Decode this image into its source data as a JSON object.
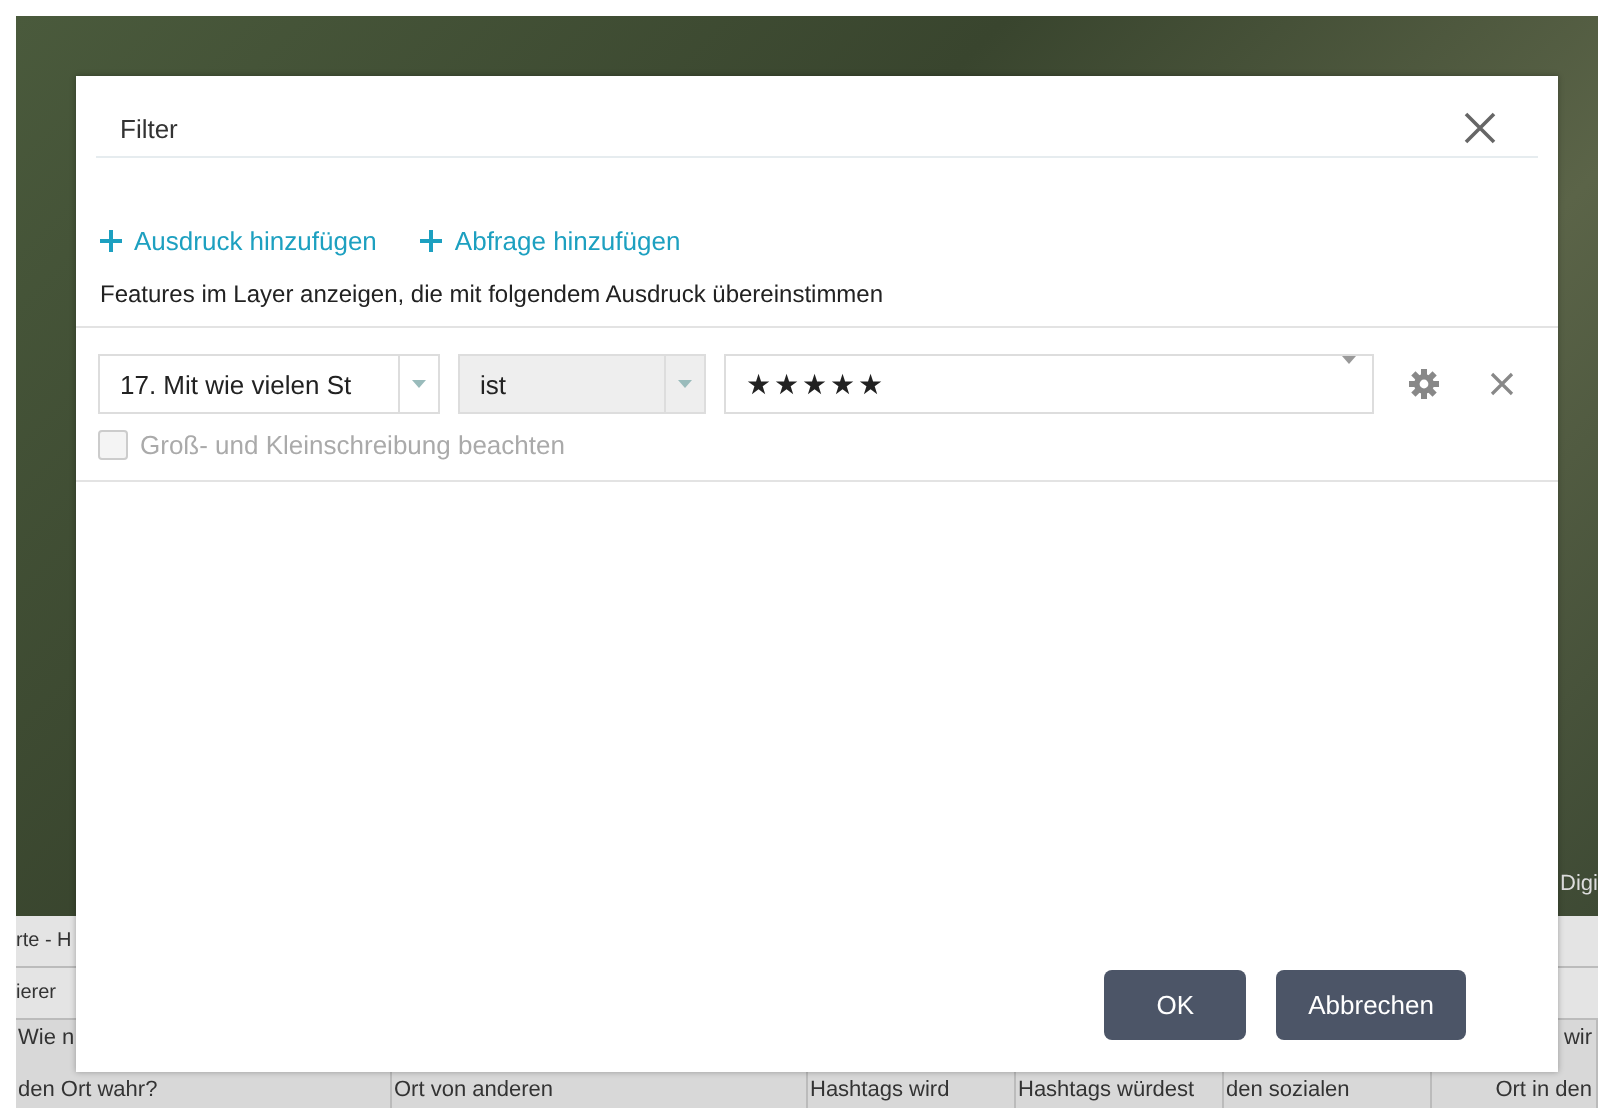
{
  "background": {
    "map_label": "Digi",
    "table": {
      "header": "rte - H",
      "toolbar": "ierer",
      "cells": [
        {
          "lines": [
            "Wie n",
            "den Ort wahr?"
          ]
        },
        {
          "lines": [
            "Ort von anderen"
          ]
        },
        {
          "lines": [
            "Hashtags wird"
          ]
        },
        {
          "lines": [
            "Hashtags würdest"
          ]
        },
        {
          "lines": [
            "den sozialen"
          ]
        },
        {
          "lines": [
            "wir",
            "Ort in den"
          ]
        }
      ]
    }
  },
  "dialog": {
    "title": "Filter",
    "actions": [
      {
        "label": "Ausdruck hinzufügen"
      },
      {
        "label": "Abfrage hinzufügen"
      }
    ],
    "description": "Features im Layer anzeigen, die mit folgendem Ausdruck übereinstimmen",
    "expression": {
      "field": "17. Mit wie vielen St",
      "operator": "ist",
      "value": "★★★★★",
      "case_sensitive": {
        "label": "Groß- und Kleinschreibung beachten",
        "checked": false,
        "disabled": true
      }
    },
    "buttons": [
      {
        "label": "OK"
      },
      {
        "label": "Abbrechen"
      }
    ]
  }
}
